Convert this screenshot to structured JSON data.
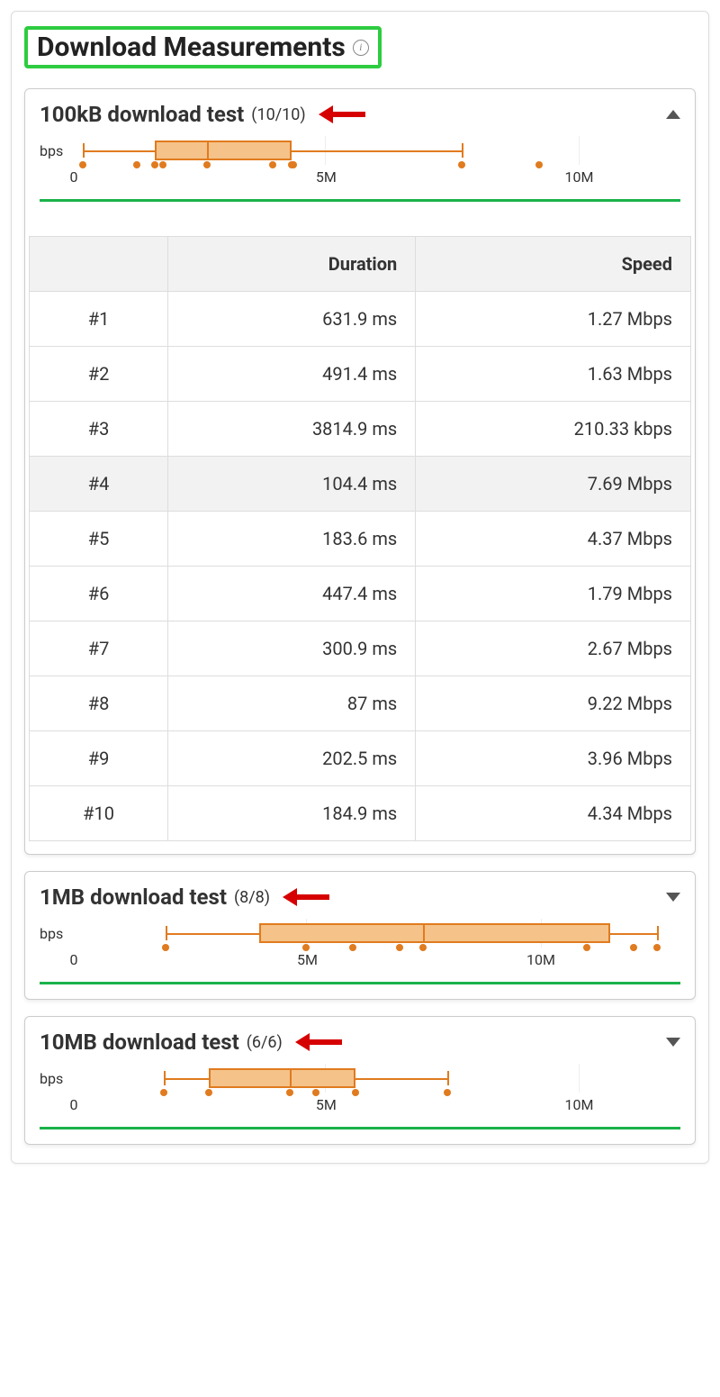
{
  "title": "Download Measurements",
  "section1": {
    "title": "100kB download test",
    "count": "(10/10)",
    "expanded": true,
    "ylabel": "bps",
    "ticks": [
      "0",
      "5M",
      "10M"
    ],
    "table": {
      "headers": [
        "",
        "Duration",
        "Speed"
      ],
      "rows": [
        {
          "n": "#1",
          "duration": "631.9 ms",
          "speed": "1.27 Mbps",
          "hl": false
        },
        {
          "n": "#2",
          "duration": "491.4 ms",
          "speed": "1.63 Mbps",
          "hl": false
        },
        {
          "n": "#3",
          "duration": "3814.9 ms",
          "speed": "210.33 kbps",
          "hl": false
        },
        {
          "n": "#4",
          "duration": "104.4 ms",
          "speed": "7.69 Mbps",
          "hl": true
        },
        {
          "n": "#5",
          "duration": "183.6 ms",
          "speed": "4.37 Mbps",
          "hl": false
        },
        {
          "n": "#6",
          "duration": "447.4 ms",
          "speed": "1.79 Mbps",
          "hl": false
        },
        {
          "n": "#7",
          "duration": "300.9 ms",
          "speed": "2.67 Mbps",
          "hl": false
        },
        {
          "n": "#8",
          "duration": "87 ms",
          "speed": "9.22 Mbps",
          "hl": false
        },
        {
          "n": "#9",
          "duration": "202.5 ms",
          "speed": "3.96 Mbps",
          "hl": false
        },
        {
          "n": "#10",
          "duration": "184.9 ms",
          "speed": "4.34 Mbps",
          "hl": false
        }
      ]
    }
  },
  "section2": {
    "title": "1MB download test",
    "count": "(8/8)",
    "expanded": false,
    "ylabel": "bps",
    "ticks": [
      "0",
      "5M",
      "10M"
    ]
  },
  "section3": {
    "title": "10MB download test",
    "count": "(6/6)",
    "expanded": false,
    "ylabel": "bps",
    "ticks": [
      "0",
      "5M",
      "10M"
    ]
  },
  "chart_data": [
    {
      "type": "boxplot",
      "title": "100kB download test bps",
      "xlabel_unit": "bps",
      "xlim": [
        0,
        12000000
      ],
      "ticks": [
        0,
        5000000,
        10000000
      ],
      "box": {
        "min": 210000,
        "q1": 1630000,
        "median": 2670000,
        "q3": 4340000,
        "max": 7690000
      },
      "points_bps": [
        1270000,
        1630000,
        210000,
        7690000,
        4370000,
        1790000,
        2670000,
        9220000,
        3960000,
        4340000
      ]
    },
    {
      "type": "boxplot",
      "title": "1MB download test bps",
      "xlabel_unit": "bps",
      "xlim": [
        0,
        13000000
      ],
      "ticks": [
        0,
        5000000,
        10000000
      ],
      "box": {
        "min": 2000000,
        "q1": 4000000,
        "median": 7500000,
        "q3": 11500000,
        "max": 12500000
      },
      "points_bps": [
        2000000,
        5000000,
        6000000,
        7000000,
        7500000,
        11000000,
        12000000,
        12500000
      ]
    },
    {
      "type": "boxplot",
      "title": "10MB download test bps",
      "xlabel_unit": "bps",
      "xlim": [
        0,
        12000000
      ],
      "ticks": [
        0,
        5000000,
        10000000
      ],
      "box": {
        "min": 1800000,
        "q1": 2700000,
        "median": 4300000,
        "q3": 5600000,
        "max": 7400000
      },
      "points_bps": [
        1800000,
        2700000,
        4300000,
        4800000,
        5600000,
        7400000
      ]
    }
  ]
}
